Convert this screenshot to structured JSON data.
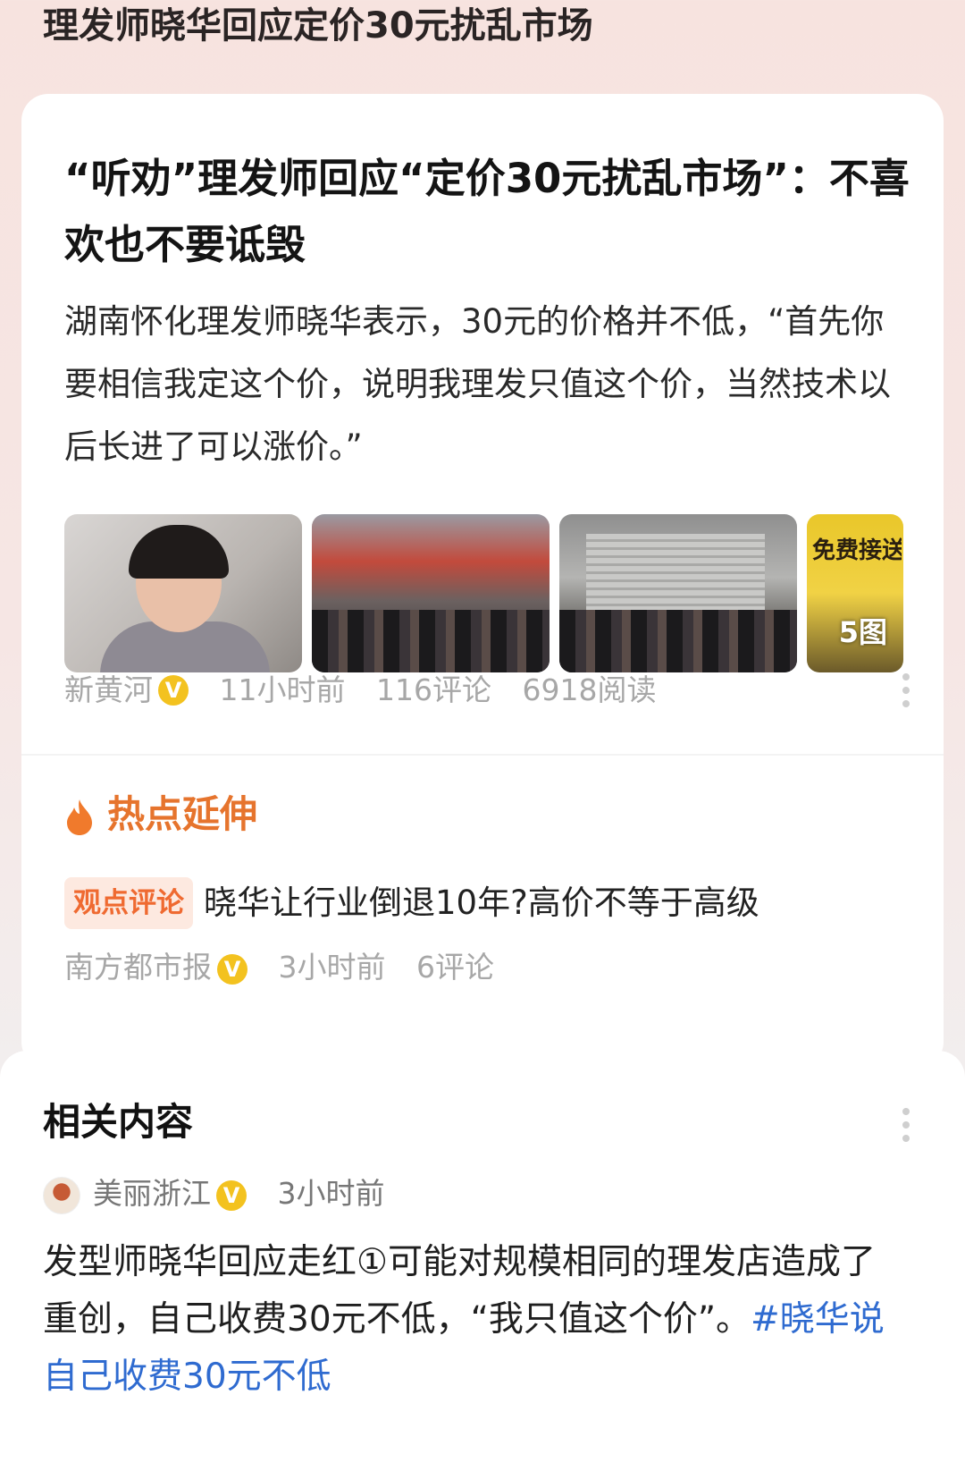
{
  "page": {
    "title": "理发师晓华回应定价30元扰乱市场"
  },
  "article": {
    "headline": "“听劝”理发师回应“定价30元扰乱市场”：不喜欢也不要诋毁",
    "summary": "湖南怀化理发师晓华表示，30元的价格并不低，“首先你要相信我定这个价，说明我理发只值这个价，当然技术以后长进了可以涨价。”",
    "image_count_badge": "5图",
    "image4_banner_text": "免费接送 晓华老师粉丝团",
    "source": "新黄河",
    "verified_mark": "V",
    "time": "11小时前",
    "comments": "116评论",
    "reads": "6918阅读"
  },
  "hot_extension": {
    "title": "热点延伸",
    "item": {
      "tag": "观点评论",
      "text": "晓华让行业倒退10年?高价不等于高级",
      "source": "南方都市报",
      "verified_mark": "V",
      "time": "3小时前",
      "comments": "6评论"
    }
  },
  "related": {
    "title": "相关内容",
    "post": {
      "author": "美丽浙江",
      "verified_mark": "V",
      "time": "3小时前",
      "text": "发型师晓华回应走红①可能对规模相同的理发店造成了重创，自己收费30元不低，“我只值这个价”。",
      "hashtag": "#晓华说自己收费30元不低"
    }
  },
  "colors": {
    "accent_orange": "#e6742d",
    "tag_bg": "#fde9e0",
    "verified_yellow": "#f3c21f",
    "hashtag_blue": "#2f6bd0",
    "meta_gray": "#a7a7a7"
  },
  "icons": [
    "v-verified-icon",
    "more-vertical-icon",
    "flame-icon",
    "avatar-image"
  ]
}
